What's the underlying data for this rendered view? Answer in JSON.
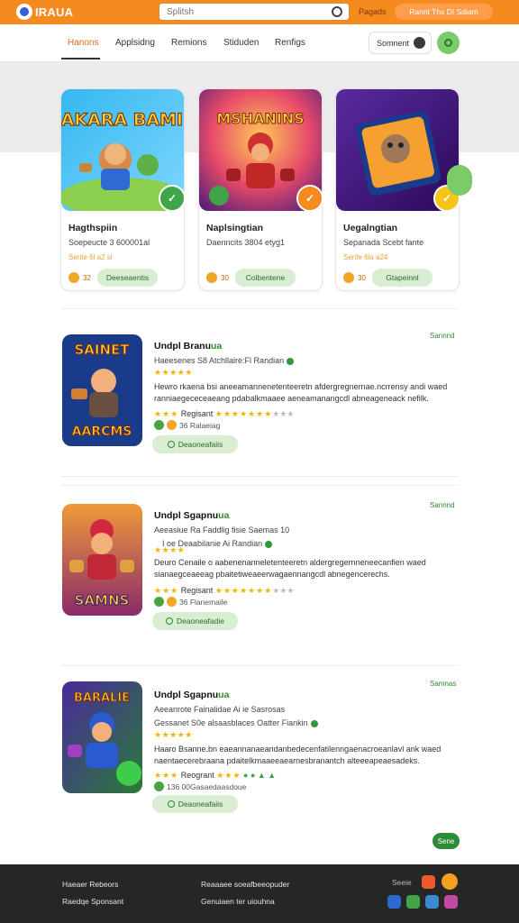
{
  "header": {
    "logo_text": "IRAUA",
    "search_placeholder": "Splitsh",
    "top_link": "Pagads",
    "pill_text": "Rannt Ths DI Sdiam"
  },
  "nav": {
    "tabs": [
      "Hanons",
      "Applsidng",
      "Remions",
      "Stiduden",
      "Renfigs"
    ],
    "account_label": "Somnent"
  },
  "featured": [
    {
      "art_text": "BAKARA BAMIN",
      "title": "Hagthspiin",
      "subtitle": "Soepeucte 3 600001al",
      "meta": "Serite 6l a2 sl",
      "count": "32",
      "button": "Deeseaentis",
      "badge_color": "#3fa548"
    },
    {
      "art_text": "MSHANINS",
      "title": "Naplsingtian",
      "subtitle": "Daenncits 3804 etyg1",
      "meta": "",
      "count": "30",
      "button": "Colbentene",
      "badge_color": "#f58a1f"
    },
    {
      "art_text": "",
      "title": "Uegalngtian",
      "subtitle": "Sepanada Scebt fante",
      "meta": "Senfe 6la a24",
      "count": "30",
      "button": "Gtapeinnl",
      "badge_color": "#f5c518"
    }
  ],
  "items": [
    {
      "art_top": "SAINET",
      "art_bottom": "AARCMS",
      "tag": "Sannnd",
      "title": "Undpl Branu",
      "title_hl": "ua",
      "line1": "Haeesenes   S8 Atchllaire:Fl Randian",
      "line2": "",
      "stars": "★★★★★",
      "desc": "Hewro rkaena bsi aneeamannenetenteeretn afdergregnernae.ncrrensy andi waed ranniaegececeaeang pdabalkmaaee aeneamanangcdl abneageneack nefilk.",
      "rating_label": "Regisant",
      "rating_stars": "★★★★★★★",
      "rating_gray": "★★★",
      "icons_text": "36  Ralaeiag",
      "button": "Deaoneafaiis"
    },
    {
      "art_top": "",
      "art_bottom": "SAMNS",
      "tag": "Sannnd",
      "title": "Undpl Sgapnu",
      "title_hl": "ua",
      "line1": "Aeeasiue   Ra Faddlig fisie Saemas 10",
      "line2": "I oe Deaabilanie Ai Randian",
      "stars": "★★★★",
      "desc": "Deuro Cenaile o aabenenanneletenteeretn aldergregernneneecanfien waed sianaegceaeeag pbaitetiweaeerwagaennangcdl abnegencerechs.",
      "rating_label": "Regisant",
      "rating_stars": "★★★★★★★",
      "rating_gray": "★★★",
      "icons_text": "36  Flanemaile",
      "button": "Deaoneafadie"
    },
    {
      "art_top": "BARALIE",
      "art_bottom": "",
      "tag": "Samnas",
      "title": "Undpl Sgapnu",
      "title_hl": "ua",
      "line1": "Aeeanrote   Fainalidae Ai ie Sasrosas",
      "line2": "Gessanet   S0e alsaasblaces Oatter Fiankin",
      "stars": "★★★★★",
      "desc": "Haaro Bsanne.bn eaeannanaeandanbedecenfatilenngaenacroeanlavl ank waed naentaecerebraana pdaitelkmaaeeaearnesbranantch alteeeapeaesadeks.",
      "rating_label": "Reogrant",
      "rating_stars": "★★★",
      "rating_gray": "",
      "icons_text": "136 00Gasaedaasdoue",
      "button": "Deaoneafaiis"
    }
  ],
  "more_button": "Sene",
  "footer": {
    "col1": [
      "Haeaer Rebeors",
      "Raedqe Sponsant"
    ],
    "col2": [
      "Reaaaee soeafbeeopuder",
      "Genuiaen ter uiouhna"
    ],
    "label": "Seeie"
  },
  "colors": {
    "brand_orange": "#f58a1f",
    "accent_green": "#3fa548",
    "footer_bg": "#262626"
  }
}
